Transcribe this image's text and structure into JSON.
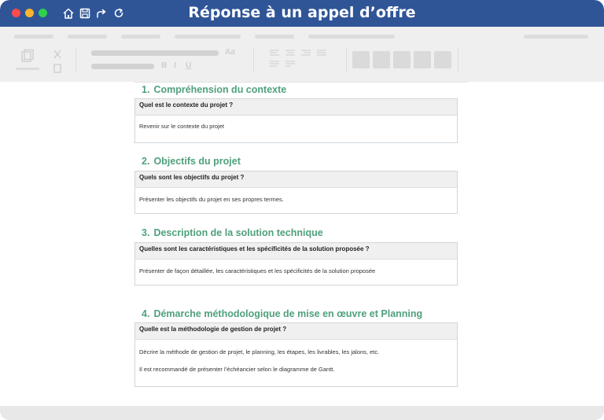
{
  "window": {
    "title": "Réponse à un appel d’offre"
  },
  "colors": {
    "titlebar": "#2f5597",
    "heading": "#4fa07c",
    "toolbar_bg": "#efefef"
  },
  "toolbar": {
    "bold_label": "B",
    "italic_label": "I",
    "underline_label": "U",
    "font_size_label": "Aa"
  },
  "sections": [
    {
      "number": "1.",
      "heading": "Compréhension du contexte",
      "question": "Quel est le contexte du projet ?",
      "answer": [
        "Revenir sur le contexte du projet"
      ]
    },
    {
      "number": "2.",
      "heading": "Objectifs du projet",
      "question": "Quels sont les objectifs du projet ?",
      "answer": [
        "Présenter les objectifs du projet en ses propres termes."
      ]
    },
    {
      "number": "3.",
      "heading": "Description de la solution technique",
      "question": "Quelles sont les caractéristiques et les spécificités de la solution proposée ?",
      "answer": [
        "Présenter de façon détaillée, les caractéristiques et les spécificités de la solution proposée"
      ]
    },
    {
      "number": "4.",
      "heading": "Démarche méthodologique de mise en œuvre et Planning",
      "question": "Quelle est la méthodologie de gestion de projet ?",
      "answer": [
        "Décrire la méthode de gestion de projet, le planning, les étapes, les livrables, les jalons, etc.",
        "Il est recommandé de présenter l’échéancier selon le diagramme de Gantt."
      ]
    }
  ]
}
